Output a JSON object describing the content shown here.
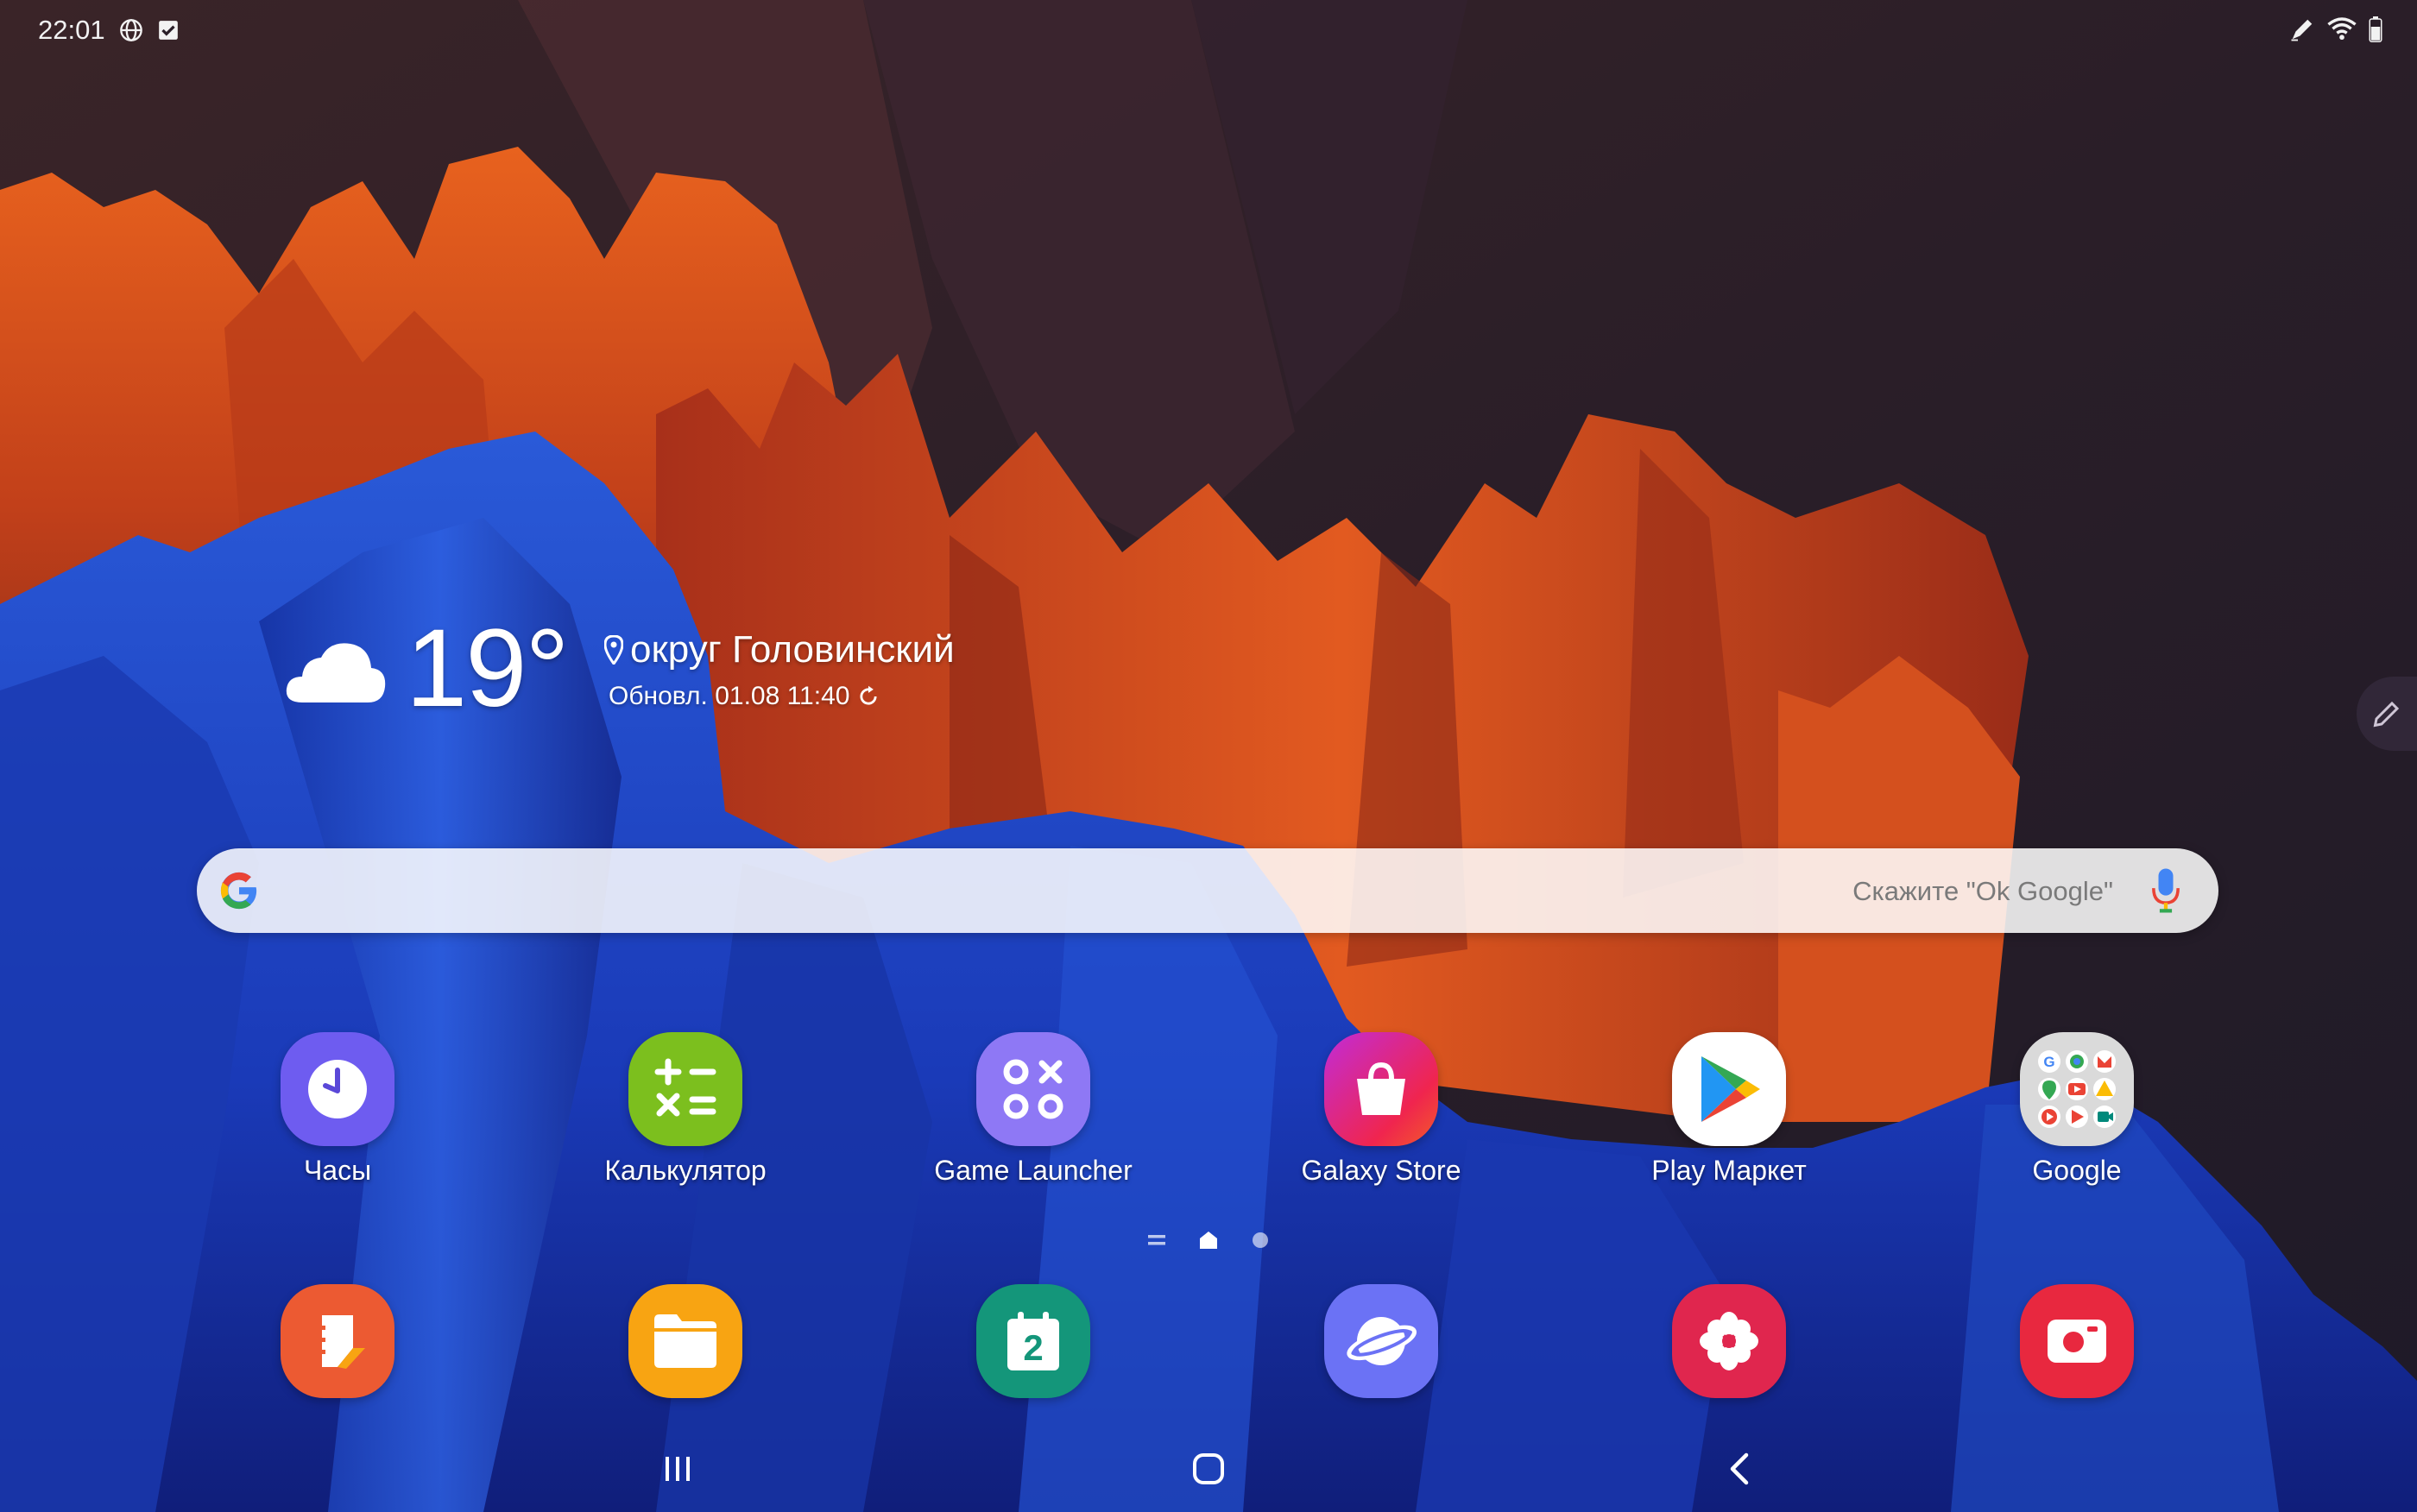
{
  "status_bar": {
    "time": "22:01"
  },
  "weather": {
    "temperature": "19°",
    "location": "округ Головинский",
    "updated": "Обновл. 01.08 11:40"
  },
  "search": {
    "hint": "Скажите \"Ok Google\""
  },
  "apps_row1": [
    {
      "label": "Часы",
      "icon": "clock-icon"
    },
    {
      "label": "Калькулятор",
      "icon": "calculator-icon"
    },
    {
      "label": "Game Launcher",
      "icon": "game-launcher-icon"
    },
    {
      "label": "Galaxy Store",
      "icon": "shopping-bag-icon"
    },
    {
      "label": "Play Маркет",
      "icon": "play-store-icon"
    },
    {
      "label": "Google",
      "icon": "google-folder-icon"
    }
  ],
  "dock": [
    {
      "icon": "samsung-notes-icon"
    },
    {
      "icon": "my-files-icon"
    },
    {
      "icon": "calendar-icon",
      "text": "2"
    },
    {
      "icon": "samsung-internet-icon"
    },
    {
      "icon": "gallery-icon"
    },
    {
      "icon": "screen-recorder-icon"
    }
  ],
  "colors": {
    "clock": "#6e5cf0",
    "calculator": "#7cbf1e",
    "game_launcher": "#8e78f5",
    "galaxy_store": "#e9256f",
    "play_store": "#ffffff",
    "google_folder": "#dadada",
    "notes": "#ec5a32",
    "files": "#f8a412",
    "calendar": "#14967a",
    "internet": "#6b72f5",
    "gallery": "#e0264e",
    "recorder": "#e8283f"
  }
}
